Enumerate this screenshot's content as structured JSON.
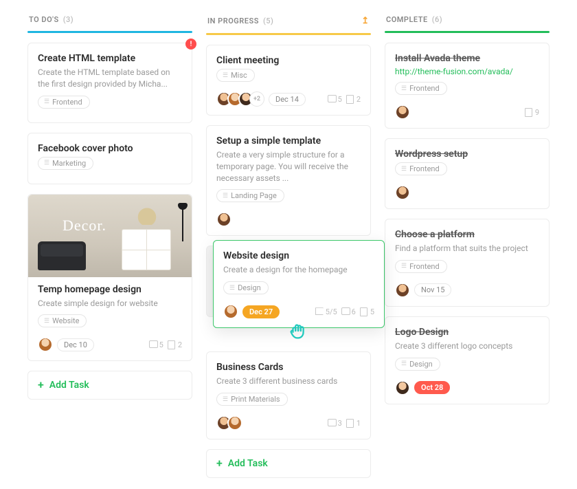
{
  "columns": {
    "todo": {
      "title": "TO DO'S",
      "count": "(3)"
    },
    "inprog": {
      "title": "IN PROGRESS",
      "count": "(5)"
    },
    "done": {
      "title": "COMPLETE",
      "count": "(6)"
    }
  },
  "addTaskLabel": "Add Task",
  "todo": {
    "c0": {
      "title": "Create HTML template",
      "desc": "Create the HTML template based on the first design provided by Micha...",
      "tag": "Frontend"
    },
    "c1": {
      "title": "Facebook cover photo",
      "tag": "Marketing"
    },
    "c2": {
      "title": "Temp homepage design",
      "desc": "Create simple design for website",
      "tag": "Website",
      "date": "Dec 10",
      "comments": "5",
      "files": "2",
      "imageText": "Decor."
    }
  },
  "inprog": {
    "c0": {
      "title": "Client meeting",
      "tag": "Misc",
      "date": "Dec 14",
      "avatarsMore": "+2",
      "comments": "5",
      "files": "2"
    },
    "c1": {
      "title": "Setup a simple template",
      "desc": "Create a very simple structure for a temporary page. You will receive the necessary assets ...",
      "tag": "Landing Page"
    },
    "drag": {
      "title": "Website design",
      "desc": "Create a design for the homepage",
      "tag": "Design",
      "date": "Dec 27",
      "progress": "5/5",
      "comments": "6",
      "files": "5"
    },
    "c3": {
      "title": "Business Cards",
      "desc": "Create 3 different business cards",
      "tag": "Print Materials",
      "comments": "3",
      "files": "1"
    }
  },
  "done": {
    "c0": {
      "title": "Install Avada theme",
      "link": "http://theme-fusion.com/avada/",
      "tag": "Frontend",
      "files": "9"
    },
    "c1": {
      "title": "Wordpress setup",
      "tag": "Frontend"
    },
    "c2": {
      "title": "Choose a platform",
      "desc": "Find a platform that suits the project",
      "tag": "Frontend",
      "date": "Nov 15"
    },
    "c3": {
      "title": "Logo Design",
      "desc": "Create 3 different logo concepts",
      "tag": "Design",
      "date": "Oct 28"
    }
  }
}
